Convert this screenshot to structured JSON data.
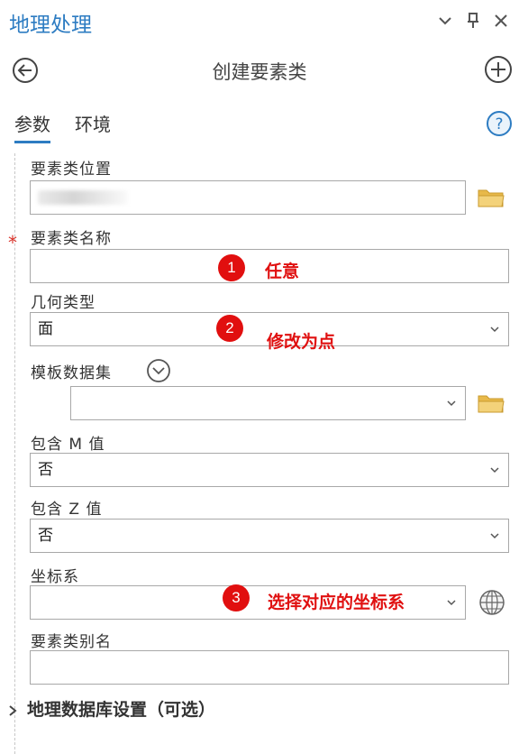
{
  "pane": {
    "title": "地理处理",
    "tool_title": "创建要素类"
  },
  "tabs": [
    {
      "label": "参数",
      "active": true
    },
    {
      "label": "环境",
      "active": false
    }
  ],
  "fields": {
    "location": {
      "label": "要素类位置",
      "value": ""
    },
    "name": {
      "label": "要素类名称",
      "value": "",
      "required_marker": "*"
    },
    "geometry": {
      "label": "几何类型",
      "value": "面"
    },
    "template": {
      "label": "模板数据集",
      "value": ""
    },
    "has_m": {
      "label": "包含 M 值",
      "value": "否"
    },
    "has_z": {
      "label": "包含 Z 值",
      "value": "否"
    },
    "spatial_ref": {
      "label": "坐标系",
      "value": ""
    },
    "alias": {
      "label": "要素类别名",
      "value": ""
    }
  },
  "annotations": [
    {
      "number": "1",
      "text": "任意"
    },
    {
      "number": "2",
      "text": "修改为点"
    },
    {
      "number": "3",
      "text": "选择对应的坐标系"
    }
  ],
  "section": {
    "label": "地理数据库设置（可选）",
    "collapsed": true
  },
  "colors": {
    "accent": "#2d7cc2",
    "annotation": "#e10f0f",
    "folder": "#e8b94a",
    "required": "#d9332a"
  },
  "icons": [
    "chevron-down-icon",
    "pin-icon",
    "close-icon",
    "back-arrow-icon",
    "add-icon",
    "help-icon",
    "folder-icon",
    "expand-icon",
    "globe-icon",
    "chevron-right-icon"
  ]
}
